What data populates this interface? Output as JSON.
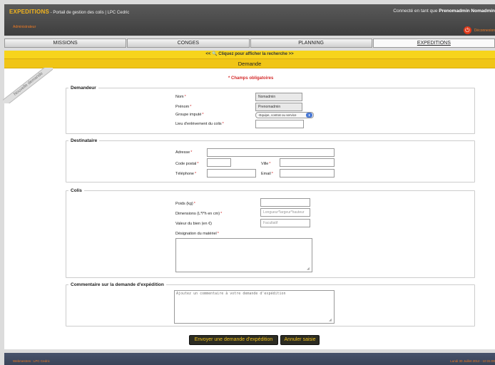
{
  "header": {
    "brand": "EXPEDITIONS",
    "subtitle": " - Portail de gestion des colis | LPC Cedric",
    "connected_prefix": "Connecté en tant que ",
    "connected_user": "Prenomadmin Nomadmin",
    "role": "Administrateur",
    "logout": "Déconnexion"
  },
  "tabs": [
    {
      "label": "MISSIONS",
      "active": false
    },
    {
      "label": "CONGES",
      "active": false
    },
    {
      "label": "PLANNING",
      "active": false
    },
    {
      "label": "EXPEDITIONS",
      "active": true
    }
  ],
  "search_bar": {
    "prefix": "<< ",
    "text": " Cliquez pour afficher la recherche >>"
  },
  "section_title": "Demande",
  "ribbon": "Nouvelle demande",
  "required_note": "* Champs obligatoires",
  "demandeur": {
    "legend": "Demandeur",
    "nom_label": "Nom",
    "nom_value": "Nomadmin",
    "prenom_label": "Prénom",
    "prenom_value": "Prenomadmin",
    "groupe_label": "Groupe imputé",
    "groupe_value": "-Equipe, contrat ou service",
    "lieu_label": "Lieu d'enlèvement du colis",
    "lieu_value": ""
  },
  "destinataire": {
    "legend": "Destinataire",
    "adresse_label": "Adresse",
    "cp_label": "Code postal",
    "ville_label": "Ville",
    "tel_label": "Téléphone",
    "email_label": "Email"
  },
  "colis": {
    "legend": "Colis",
    "poids_label": "Poids (kg)",
    "dimensions_label": "Dimensions (L*l*h en cm)",
    "dimensions_placeholder": "Longueur*largeur*hauteur",
    "valeur_label": "Valeur du bien (en €)",
    "valeur_placeholder": "Facultatif",
    "designation_label": "Désignation du matériel"
  },
  "commentaire": {
    "legend": "Commentaire sur la demande d'expédition",
    "placeholder": "Ajoutez un commentaire à votre demande d'expédition"
  },
  "buttons": {
    "submit": "Envoyer une demande d'expédition",
    "cancel": "Annuler saisie"
  },
  "required_mark": "*",
  "footer": {
    "left": "Webmestres : LPC Cedric",
    "right": "Lundi 30 Juillet 2012 - 10:31:00"
  }
}
